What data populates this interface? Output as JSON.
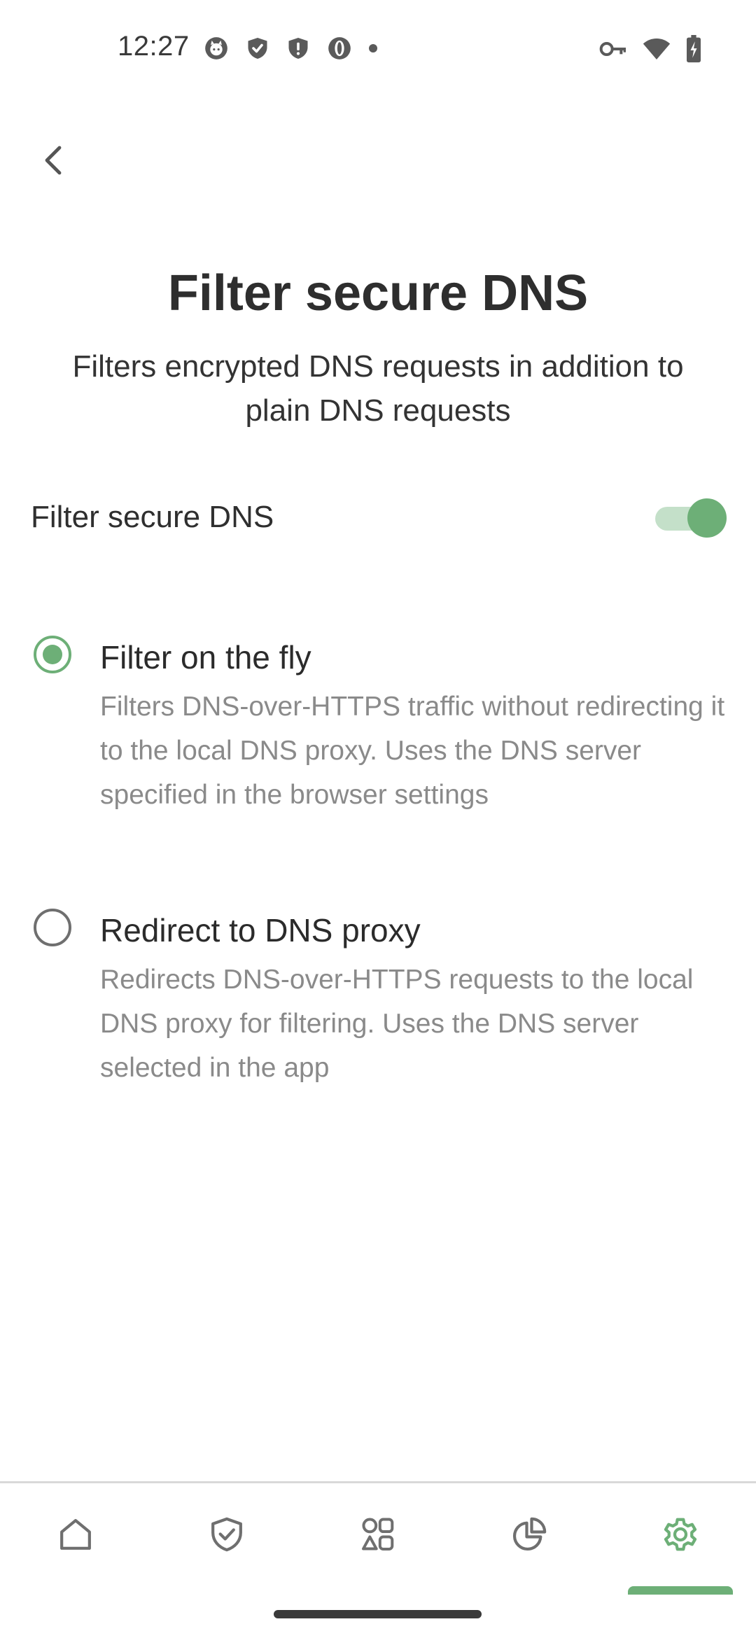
{
  "status_bar": {
    "time": "12:27",
    "left_icons": [
      "github-cat-icon",
      "shield-check-icon",
      "shield-alert-icon",
      "opera-icon",
      "notification-dot-icon"
    ],
    "right_icons": [
      "vpn-key-icon",
      "wifi-icon",
      "battery-charging-icon"
    ]
  },
  "header": {
    "back_icon": "chevron-left-icon",
    "title": "Filter secure DNS",
    "subtitle": "Filters encrypted DNS requests in addition to plain DNS requests"
  },
  "toggle": {
    "label": "Filter secure DNS",
    "enabled": true
  },
  "options": [
    {
      "title": "Filter on the fly",
      "description": "Filters DNS-over-HTTPS traffic without redirecting it to the local DNS proxy. Uses the DNS server specified in the browser settings",
      "selected": true
    },
    {
      "title": "Redirect to DNS proxy",
      "description": "Redirects DNS-over-HTTPS requests to the local DNS proxy for filtering. Uses the DNS server selected in the app",
      "selected": false
    }
  ],
  "bottom_nav": {
    "items": [
      {
        "icon": "home-icon",
        "active": false
      },
      {
        "icon": "shield-check-icon",
        "active": false
      },
      {
        "icon": "apps-grid-icon",
        "active": false
      },
      {
        "icon": "pie-chart-icon",
        "active": false
      },
      {
        "icon": "gear-icon",
        "active": true
      }
    ]
  },
  "colors": {
    "accent": "#6daf77",
    "accent_light": "#c4e0c9",
    "text_primary": "#2b2b2b",
    "text_secondary": "#8a8a8a",
    "icon_gray": "#6f6f6f"
  }
}
